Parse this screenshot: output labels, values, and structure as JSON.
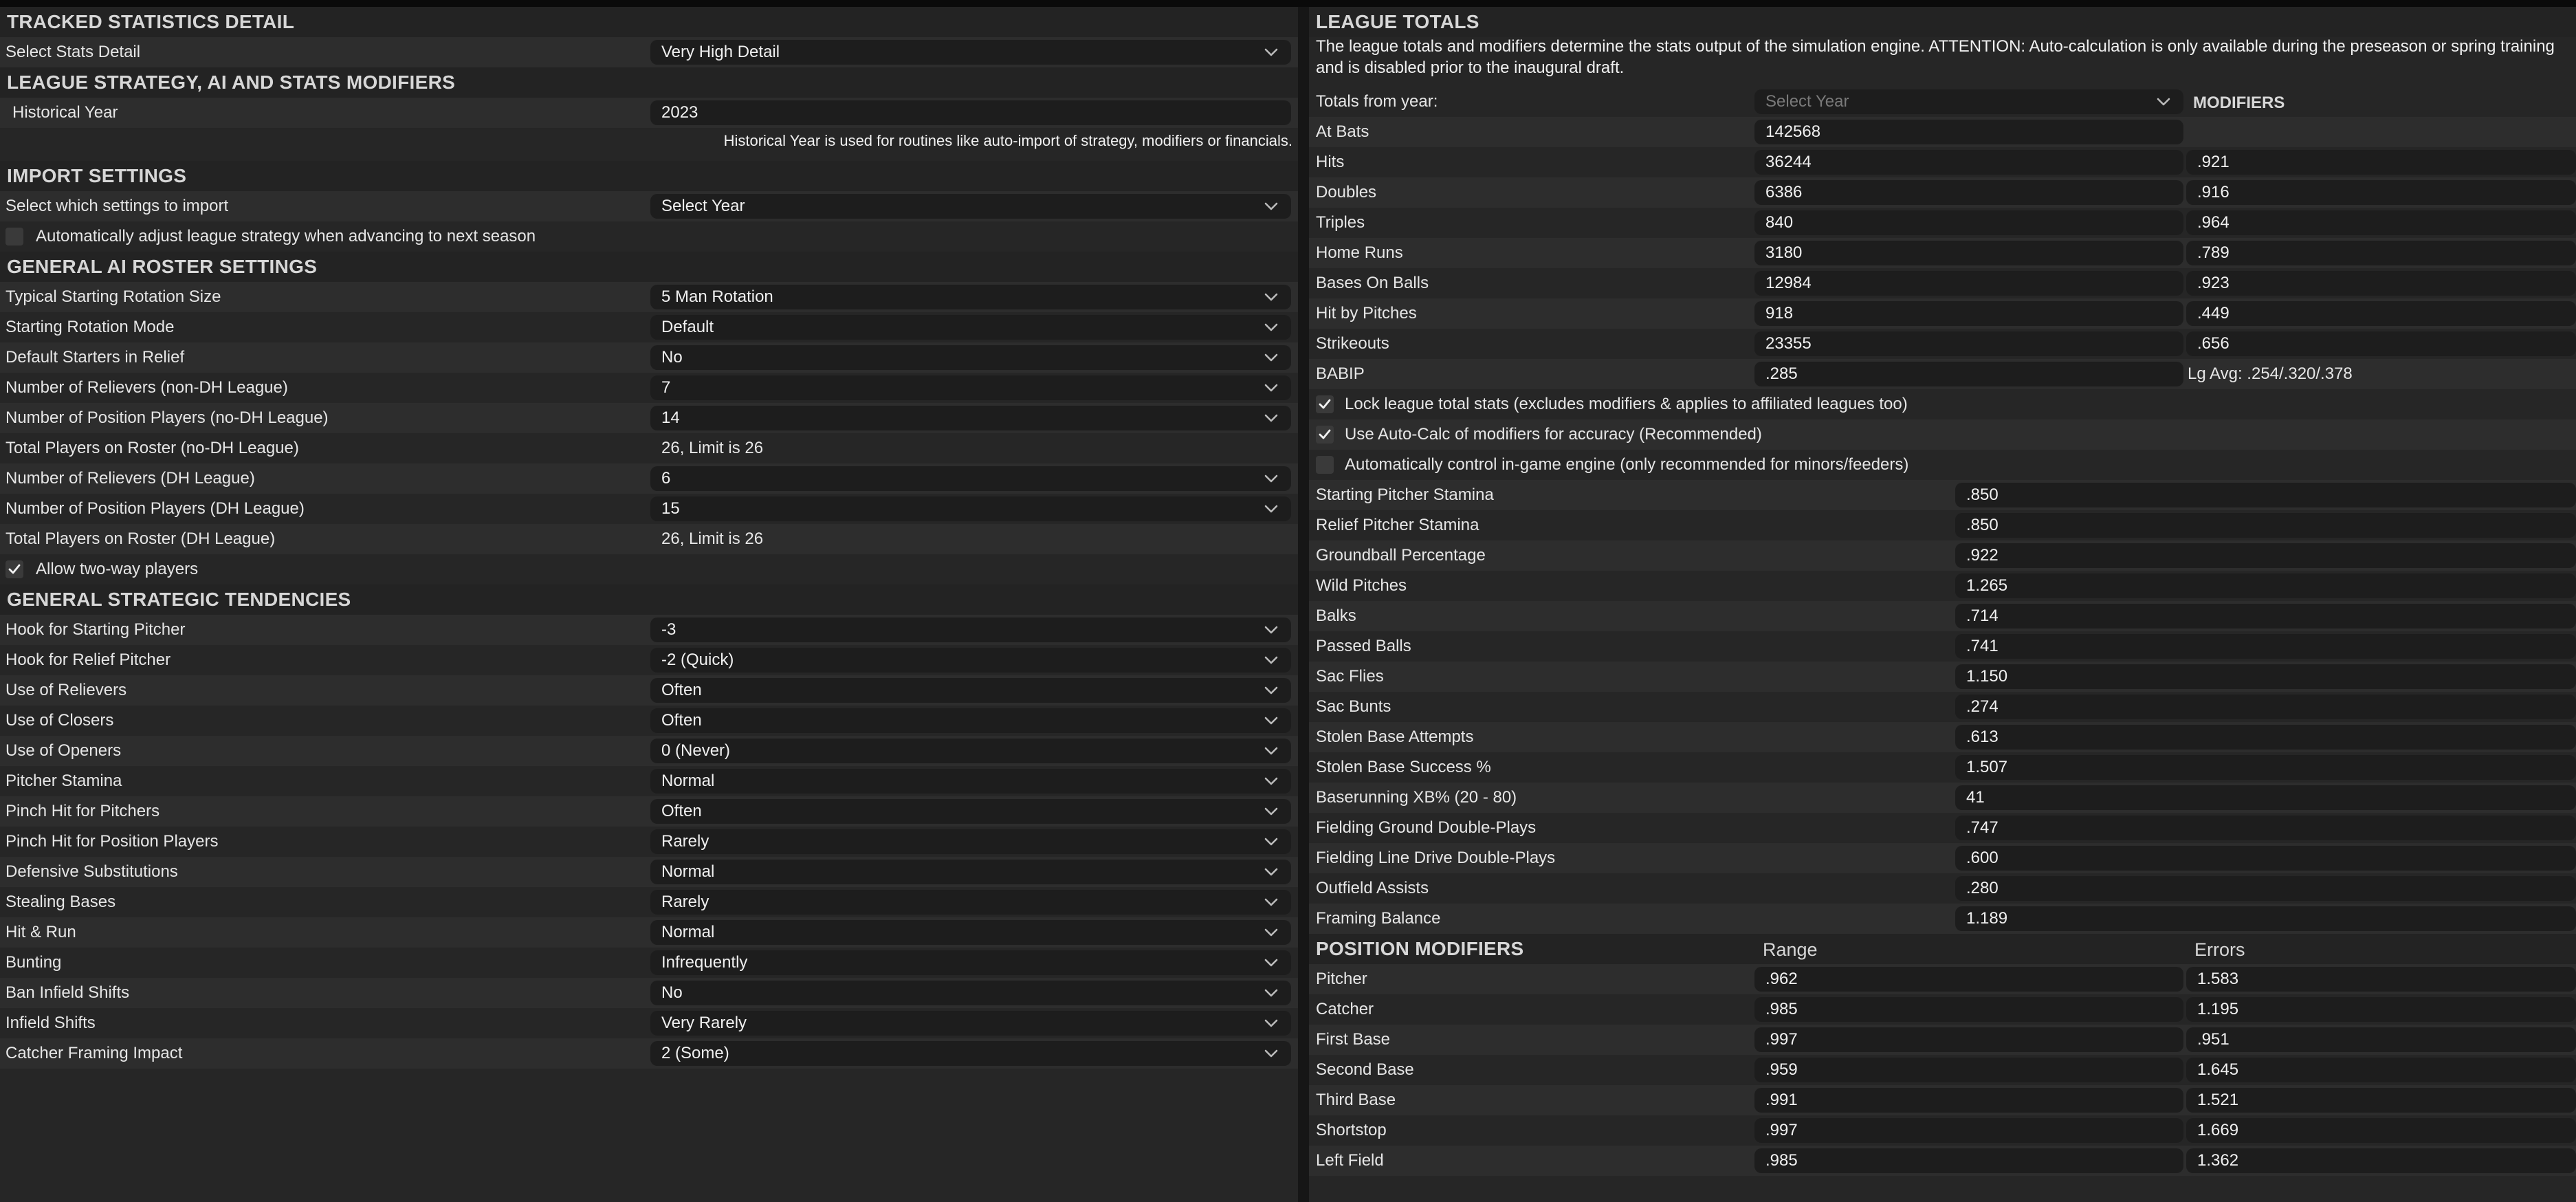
{
  "left": {
    "tracked": {
      "header": "TRACKED STATISTICS DETAIL",
      "rows": [
        {
          "label": "Select Stats Detail",
          "value": "Very High Detail"
        }
      ]
    },
    "strategy": {
      "header": "LEAGUE STRATEGY, AI AND STATS MODIFIERS",
      "historical_year_label": "Historical Year",
      "historical_year_value": "2023",
      "historical_note": "Historical Year is used for routines like auto-import of strategy, modifiers or financials."
    },
    "import": {
      "header": "IMPORT SETTINGS",
      "select_label": "Select which settings to import",
      "select_value": "Select Year",
      "auto_adjust_label": "Automatically adjust league strategy when advancing to next season"
    },
    "roster": {
      "header": "GENERAL AI ROSTER SETTINGS",
      "rows": [
        {
          "label": "Typical Starting Rotation Size",
          "value": "5 Man Rotation",
          "kind": "dropdown"
        },
        {
          "label": "Starting Rotation Mode",
          "value": "Default",
          "kind": "dropdown"
        },
        {
          "label": "Default Starters in Relief",
          "value": "No",
          "kind": "dropdown"
        },
        {
          "label": "Number of Relievers (non-DH League)",
          "value": "7",
          "kind": "dropdown"
        },
        {
          "label": "Number of Position Players (no-DH League)",
          "value": "14",
          "kind": "dropdown"
        },
        {
          "label": "Total Players on Roster (no-DH League)",
          "value": "26, Limit is 26",
          "kind": "text"
        },
        {
          "label": "Number of Relievers (DH League)",
          "value": "6",
          "kind": "dropdown"
        },
        {
          "label": "Number of Position Players (DH League)",
          "value": "15",
          "kind": "dropdown"
        },
        {
          "label": "Total Players on Roster (DH League)",
          "value": "26, Limit is 26",
          "kind": "text"
        }
      ],
      "two_way_label": "Allow two-way players"
    },
    "tendencies": {
      "header": "GENERAL STRATEGIC TENDENCIES",
      "rows": [
        {
          "label": "Hook for Starting Pitcher",
          "value": "-3"
        },
        {
          "label": "Hook for Relief Pitcher",
          "value": "-2 (Quick)"
        },
        {
          "label": "Use of Relievers",
          "value": "Often"
        },
        {
          "label": "Use of Closers",
          "value": "Often"
        },
        {
          "label": "Use of Openers",
          "value": "0 (Never)"
        },
        {
          "label": "Pitcher Stamina",
          "value": "Normal"
        },
        {
          "label": "Pinch Hit for Pitchers",
          "value": "Often"
        },
        {
          "label": "Pinch Hit for Position Players",
          "value": "Rarely"
        },
        {
          "label": "Defensive Substitutions",
          "value": "Normal"
        },
        {
          "label": "Stealing Bases",
          "value": "Rarely"
        },
        {
          "label": "Hit & Run",
          "value": "Normal"
        },
        {
          "label": "Bunting",
          "value": "Infrequently"
        },
        {
          "label": "Ban Infield Shifts",
          "value": "No"
        },
        {
          "label": "Infield Shifts",
          "value": "Very Rarely"
        },
        {
          "label": "Catcher Framing Impact",
          "value": "2 (Some)"
        }
      ]
    }
  },
  "right": {
    "header": "LEAGUE TOTALS",
    "description": "The league totals and modifiers determine the stats output of the simulation engine. ATTENTION: Auto-calculation is only available during the preseason or spring training and is disabled prior to the inaugural draft.",
    "totals_from_label": "Totals from year:",
    "totals_from_select": "Select Year",
    "modifiers_header": "MODIFIERS",
    "totals": [
      {
        "label": "At Bats",
        "value": "142568",
        "modifier": ""
      },
      {
        "label": "Hits",
        "value": "36244",
        "modifier": ".921"
      },
      {
        "label": "Doubles",
        "value": "6386",
        "modifier": ".916"
      },
      {
        "label": "Triples",
        "value": "840",
        "modifier": ".964"
      },
      {
        "label": "Home Runs",
        "value": "3180",
        "modifier": ".789"
      },
      {
        "label": "Bases On Balls",
        "value": "12984",
        "modifier": ".923"
      },
      {
        "label": "Hit by Pitches",
        "value": "918",
        "modifier": ".449"
      },
      {
        "label": "Strikeouts",
        "value": "23355",
        "modifier": ".656"
      }
    ],
    "babip_label": "BABIP",
    "babip_value": ".285",
    "lg_avg": "Lg Avg: .254/.320/.378",
    "checks": [
      {
        "label": "Lock league total stats (excludes modifiers & applies to affiliated leagues too)",
        "checked": true
      },
      {
        "label": "Use Auto-Calc of modifiers for accuracy (Recommended)",
        "checked": true
      },
      {
        "label": "Automatically control in-game engine (only recommended for minors/feeders)",
        "checked": false
      }
    ],
    "engine": [
      {
        "label": "Starting Pitcher Stamina",
        "value": ".850"
      },
      {
        "label": "Relief Pitcher Stamina",
        "value": ".850"
      },
      {
        "label": "Groundball Percentage",
        "value": ".922"
      },
      {
        "label": "Wild Pitches",
        "value": "1.265"
      },
      {
        "label": "Balks",
        "value": ".714"
      },
      {
        "label": "Passed Balls",
        "value": ".741"
      },
      {
        "label": "Sac Flies",
        "value": "1.150"
      },
      {
        "label": "Sac Bunts",
        "value": ".274"
      },
      {
        "label": "Stolen Base Attempts",
        "value": ".613"
      },
      {
        "label": "Stolen Base Success %",
        "value": "1.507"
      },
      {
        "label": "Baserunning XB% (20 - 80)",
        "value": "41"
      },
      {
        "label": "Fielding Ground Double-Plays",
        "value": ".747"
      },
      {
        "label": "Fielding Line Drive Double-Plays",
        "value": ".600"
      },
      {
        "label": "Outfield Assists",
        "value": ".280"
      },
      {
        "label": "Framing Balance",
        "value": "1.189"
      }
    ],
    "position_header": "POSITION MODIFIERS",
    "range_header": "Range",
    "errors_header": "Errors",
    "positions": [
      {
        "label": "Pitcher",
        "range": ".962",
        "errors": "1.583"
      },
      {
        "label": "Catcher",
        "range": ".985",
        "errors": "1.195"
      },
      {
        "label": "First Base",
        "range": ".997",
        "errors": ".951"
      },
      {
        "label": "Second Base",
        "range": ".959",
        "errors": "1.645"
      },
      {
        "label": "Third Base",
        "range": ".991",
        "errors": "1.521"
      },
      {
        "label": "Shortstop",
        "range": ".997",
        "errors": "1.669"
      },
      {
        "label": "Left Field",
        "range": ".985",
        "errors": "1.362"
      }
    ]
  }
}
